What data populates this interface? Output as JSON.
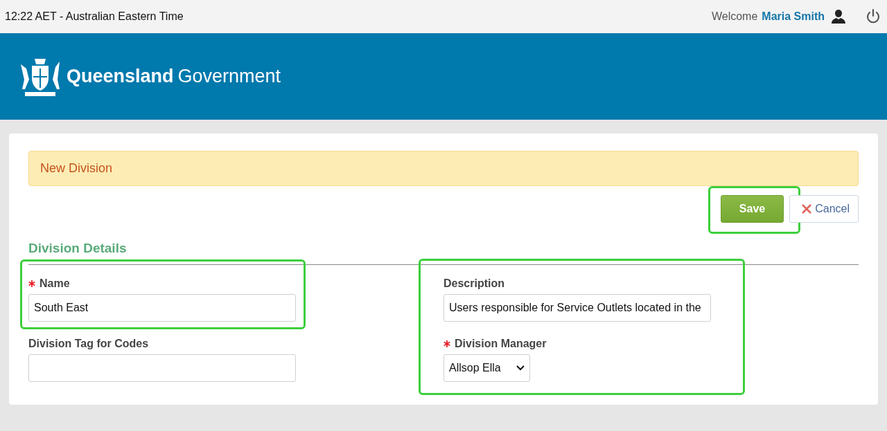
{
  "top_bar": {
    "time": "12:22 AET - Australian Eastern Time",
    "welcome": "Welcome",
    "user": "Maria Smith"
  },
  "banner": {
    "brand_bold": "Queensland",
    "brand_regular": "Government"
  },
  "alert": {
    "title": "New Division"
  },
  "actions": [
    {
      "kind": "primary",
      "label": "Save",
      "highlighted": true
    },
    {
      "kind": "cancel",
      "label": "Cancel"
    }
  ],
  "section": {
    "title": "Division Details"
  },
  "columns": [
    {
      "fields": [
        {
          "kind": "text",
          "label": "Name",
          "required": true,
          "value": "South East",
          "highlighted": true
        },
        {
          "kind": "text",
          "label": "Division Tag for Codes",
          "required": false
        }
      ]
    },
    {
      "highlighted": true,
      "fields": [
        {
          "kind": "text",
          "label": "Description",
          "required": false,
          "value": "Users responsible for Service Outlets located in the"
        },
        {
          "kind": "select",
          "label": "Division Manager",
          "required": true,
          "value": "Allsop Ella"
        }
      ]
    }
  ]
}
